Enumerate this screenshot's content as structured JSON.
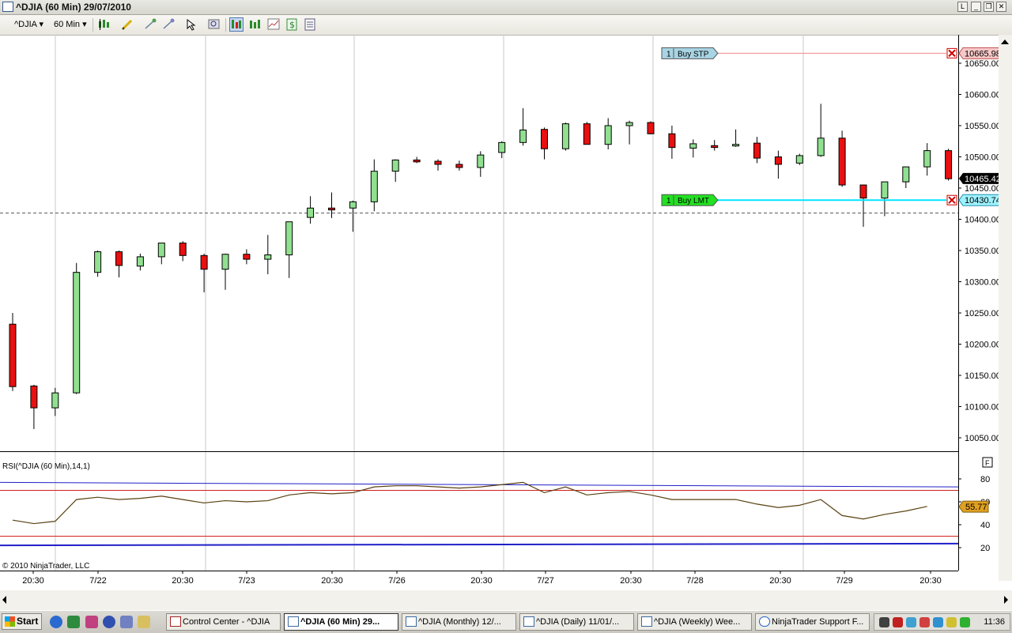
{
  "window": {
    "title": "^DJIA (60 Min)  29/07/2010",
    "buttons": [
      "L",
      "_",
      "❐",
      "✕"
    ]
  },
  "toolbar": {
    "instrument": "^DJIA",
    "interval": "60 Min",
    "icons": [
      "candlestick-icon",
      "pencil-icon",
      "bar-icon",
      "spark-icon",
      "cursor-icon",
      "zoom-icon",
      "price-marker-icon",
      "indicator-icon",
      "strategy-icon",
      "dollar-icon",
      "properties-icon"
    ]
  },
  "price_axis": {
    "ticks": [
      "10650.00",
      "10600.00",
      "10550.00",
      "10500.00",
      "10450.00",
      "10400.00",
      "10350.00",
      "10300.00",
      "10250.00",
      "10200.00",
      "10150.00",
      "10100.00",
      "10050.00"
    ],
    "current_price": "10465.42",
    "current_color": "#000000",
    "stop_price": "10665.98",
    "limit_price": "10430.74"
  },
  "orders": [
    {
      "qty": "1",
      "label": "Buy STP",
      "price": 10665.98,
      "color": "#a8d4e4",
      "line_color": "#f08a8a"
    },
    {
      "qty": "1",
      "label": "Buy LMT",
      "price": 10430.74,
      "color": "#22e022",
      "line_color": "#00e5ff"
    }
  ],
  "dashed_line_price": 10410,
  "indicator": {
    "label": "RSI(^DJIA (60 Min),14,1)",
    "ticks": [
      "80",
      "60",
      "40",
      "20"
    ],
    "value": "55.77",
    "value_color": "#e0a020",
    "upper_level": 70,
    "lower_level": 30,
    "panel_button": "F"
  },
  "copyright": "© 2010 NinjaTrader, LLC",
  "time_axis": [
    "20:30",
    "7/22",
    "20:30",
    "7/23",
    "20:30",
    "7/26",
    "20:30",
    "7/27",
    "20:30",
    "7/28",
    "20:30",
    "7/29",
    "20:30"
  ],
  "chart_data": {
    "type": "candlestick",
    "instrument": "^DJIA",
    "interval": "60 Min",
    "ylim": [
      10020,
      10680
    ],
    "up_color": "#90e090",
    "down_color": "#e81010",
    "candles": [
      {
        "o": 10232,
        "h": 10250,
        "l": 10125,
        "c": 10132
      },
      {
        "o": 10133,
        "h": 10135,
        "l": 10064,
        "c": 10098
      },
      {
        "o": 10098,
        "h": 10130,
        "l": 10085,
        "c": 10122
      },
      {
        "o": 10122,
        "h": 10330,
        "l": 10120,
        "c": 10315
      },
      {
        "o": 10315,
        "h": 10350,
        "l": 10308,
        "c": 10348
      },
      {
        "o": 10348,
        "h": 10350,
        "l": 10307,
        "c": 10326
      },
      {
        "o": 10325,
        "h": 10345,
        "l": 10318,
        "c": 10340
      },
      {
        "o": 10340,
        "h": 10362,
        "l": 10328,
        "c": 10362
      },
      {
        "o": 10362,
        "h": 10365,
        "l": 10333,
        "c": 10342
      },
      {
        "o": 10342,
        "h": 10345,
        "l": 10283,
        "c": 10320
      },
      {
        "o": 10320,
        "h": 10345,
        "l": 10287,
        "c": 10344
      },
      {
        "o": 10344,
        "h": 10352,
        "l": 10328,
        "c": 10336
      },
      {
        "o": 10336,
        "h": 10375,
        "l": 10312,
        "c": 10343
      },
      {
        "o": 10343,
        "h": 10396,
        "l": 10306,
        "c": 10396
      },
      {
        "o": 10403,
        "h": 10437,
        "l": 10393,
        "c": 10418
      },
      {
        "o": 10418,
        "h": 10443,
        "l": 10402,
        "c": 10415
      },
      {
        "o": 10418,
        "h": 10430,
        "l": 10380,
        "c": 10428
      },
      {
        "o": 10428,
        "h": 10496,
        "l": 10413,
        "c": 10477
      },
      {
        "o": 10477,
        "h": 10496,
        "l": 10460,
        "c": 10495
      },
      {
        "o": 10495,
        "h": 10500,
        "l": 10490,
        "c": 10492
      },
      {
        "o": 10493,
        "h": 10496,
        "l": 10478,
        "c": 10488
      },
      {
        "o": 10488,
        "h": 10494,
        "l": 10478,
        "c": 10483
      },
      {
        "o": 10483,
        "h": 10509,
        "l": 10468,
        "c": 10503
      },
      {
        "o": 10507,
        "h": 10525,
        "l": 10498,
        "c": 10523
      },
      {
        "o": 10523,
        "h": 10578,
        "l": 10518,
        "c": 10543
      },
      {
        "o": 10544,
        "h": 10547,
        "l": 10496,
        "c": 10513
      },
      {
        "o": 10513,
        "h": 10555,
        "l": 10510,
        "c": 10553
      },
      {
        "o": 10553,
        "h": 10556,
        "l": 10520,
        "c": 10520
      },
      {
        "o": 10520,
        "h": 10562,
        "l": 10512,
        "c": 10550
      },
      {
        "o": 10550,
        "h": 10558,
        "l": 10520,
        "c": 10555
      },
      {
        "o": 10555,
        "h": 10557,
        "l": 10536,
        "c": 10537
      },
      {
        "o": 10537,
        "h": 10550,
        "l": 10497,
        "c": 10515
      },
      {
        "o": 10514,
        "h": 10528,
        "l": 10499,
        "c": 10521
      },
      {
        "o": 10518,
        "h": 10527,
        "l": 10510,
        "c": 10515
      },
      {
        "o": 10518,
        "h": 10544,
        "l": 10516,
        "c": 10520
      },
      {
        "o": 10522,
        "h": 10532,
        "l": 10490,
        "c": 10498
      },
      {
        "o": 10500,
        "h": 10510,
        "l": 10465,
        "c": 10488
      },
      {
        "o": 10490,
        "h": 10505,
        "l": 10487,
        "c": 10502
      },
      {
        "o": 10502,
        "h": 10585,
        "l": 10500,
        "c": 10530
      },
      {
        "o": 10530,
        "h": 10542,
        "l": 10452,
        "c": 10455
      },
      {
        "o": 10455,
        "h": 10455,
        "l": 10388,
        "c": 10434
      },
      {
        "o": 10434,
        "h": 10460,
        "l": 10405,
        "c": 10460
      },
      {
        "o": 10460,
        "h": 10484,
        "l": 10450,
        "c": 10484
      },
      {
        "o": 10484,
        "h": 10522,
        "l": 10470,
        "c": 10510
      },
      {
        "o": 10510,
        "h": 10513,
        "l": 10462,
        "c": 10465
      }
    ],
    "rsi": [
      44,
      41,
      43,
      62,
      64,
      62,
      63,
      65,
      62,
      59,
      61,
      60,
      61,
      66,
      68,
      67,
      68,
      73,
      74,
      74,
      73,
      72,
      73,
      75,
      77,
      68,
      73,
      66,
      68,
      69,
      66,
      62,
      62,
      62,
      62,
      58,
      55,
      57,
      62,
      48,
      45,
      49,
      52,
      56
    ],
    "rsi_color": "#5a4010",
    "rsi_ylim": [
      0,
      100
    ],
    "rsi_levels": [
      30,
      70
    ],
    "blue_lines": [
      {
        "from": 77,
        "to": 73
      },
      {
        "from": 22,
        "to": 23.5
      }
    ]
  }
}
